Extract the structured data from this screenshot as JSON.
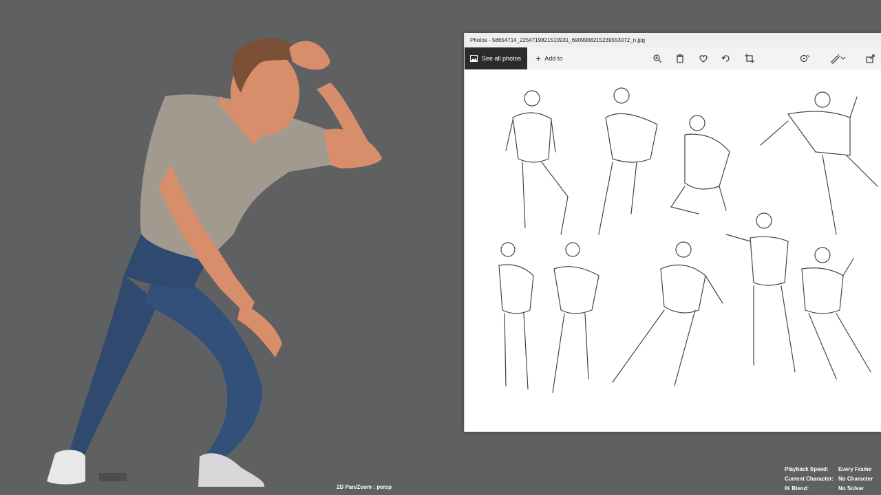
{
  "viewport": {
    "hud_camera": "2D Pan/Zoom : persp",
    "hud_stats": [
      {
        "label": "Playback Speed:",
        "value": "Every Frame"
      },
      {
        "label": "Current Character:",
        "value": "No Character"
      },
      {
        "label": "IK Blend:",
        "value": "No Solver"
      }
    ]
  },
  "photos": {
    "title": "Photos - 58654714_2254719821510931_6909908215239553072_n.jpg",
    "see_all_label": "See all photos",
    "add_to_label": "Add to",
    "icons": [
      "zoom-icon",
      "delete-icon",
      "favorite-icon",
      "rotate-icon",
      "crop-icon",
      "enhance-icon",
      "edit-icon",
      "share-icon"
    ]
  },
  "colors": {
    "viewport_bg": "#5f6062",
    "shirt": "#a39a8f",
    "skin": "#d98e6b",
    "jeans": "#2f4a6e",
    "hair": "#7a5036"
  }
}
